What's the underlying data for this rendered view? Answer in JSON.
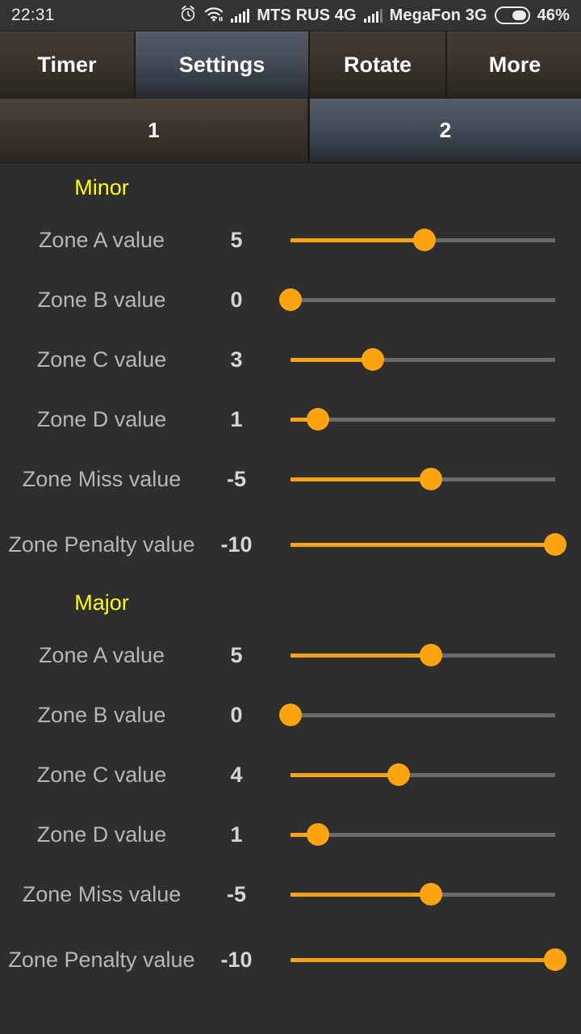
{
  "status_bar": {
    "clock": "22:31",
    "alarm_icon": "alarm-icon",
    "wifi_icon": "wifi-icon",
    "carrier_1": "MTS RUS 4G",
    "carrier_2": "MegaFon 3G",
    "battery_percent": "46%"
  },
  "tabs": [
    {
      "label": "Timer",
      "selected": false
    },
    {
      "label": "Settings",
      "selected": true
    },
    {
      "label": "Rotate",
      "selected": false
    },
    {
      "label": "More",
      "selected": false
    }
  ],
  "sub_tabs": [
    {
      "label": "1",
      "selected": false
    },
    {
      "label": "2",
      "selected": true
    }
  ],
  "sections": [
    {
      "title": "Minor",
      "rows": [
        {
          "label": "Zone A value",
          "value": "5",
          "percent": 50.5,
          "wrap": false
        },
        {
          "label": "Zone B value",
          "value": "0",
          "percent": 0.0,
          "wrap": false
        },
        {
          "label": "Zone C value",
          "value": "3",
          "percent": 31.0,
          "wrap": false
        },
        {
          "label": "Zone D value",
          "value": "1",
          "percent": 10.5,
          "wrap": false
        },
        {
          "label": "Zone Miss value",
          "value": "-5",
          "percent": 53.0,
          "wrap": false
        },
        {
          "label": "Zone Penalty value",
          "value": "-10",
          "percent": 100.0,
          "wrap": true
        }
      ]
    },
    {
      "title": "Major",
      "rows": [
        {
          "label": "Zone A value",
          "value": "5",
          "percent": 53.0,
          "wrap": false
        },
        {
          "label": "Zone B value",
          "value": "0",
          "percent": 0.0,
          "wrap": false
        },
        {
          "label": "Zone C value",
          "value": "4",
          "percent": 41.0,
          "wrap": false
        },
        {
          "label": "Zone D value",
          "value": "1",
          "percent": 10.5,
          "wrap": false
        },
        {
          "label": "Zone Miss value",
          "value": "-5",
          "percent": 53.0,
          "wrap": false
        },
        {
          "label": "Zone Penalty value",
          "value": "-10",
          "percent": 100.0,
          "wrap": true
        }
      ]
    }
  ],
  "colors": {
    "accent_orange": "#ffa310",
    "section_title_yellow": "#ffff00",
    "background": "#2e2e2e",
    "tab_selected_blue": "#454c56",
    "tab_brown": "#3a332d",
    "track_gray": "#6b6b6b"
  }
}
